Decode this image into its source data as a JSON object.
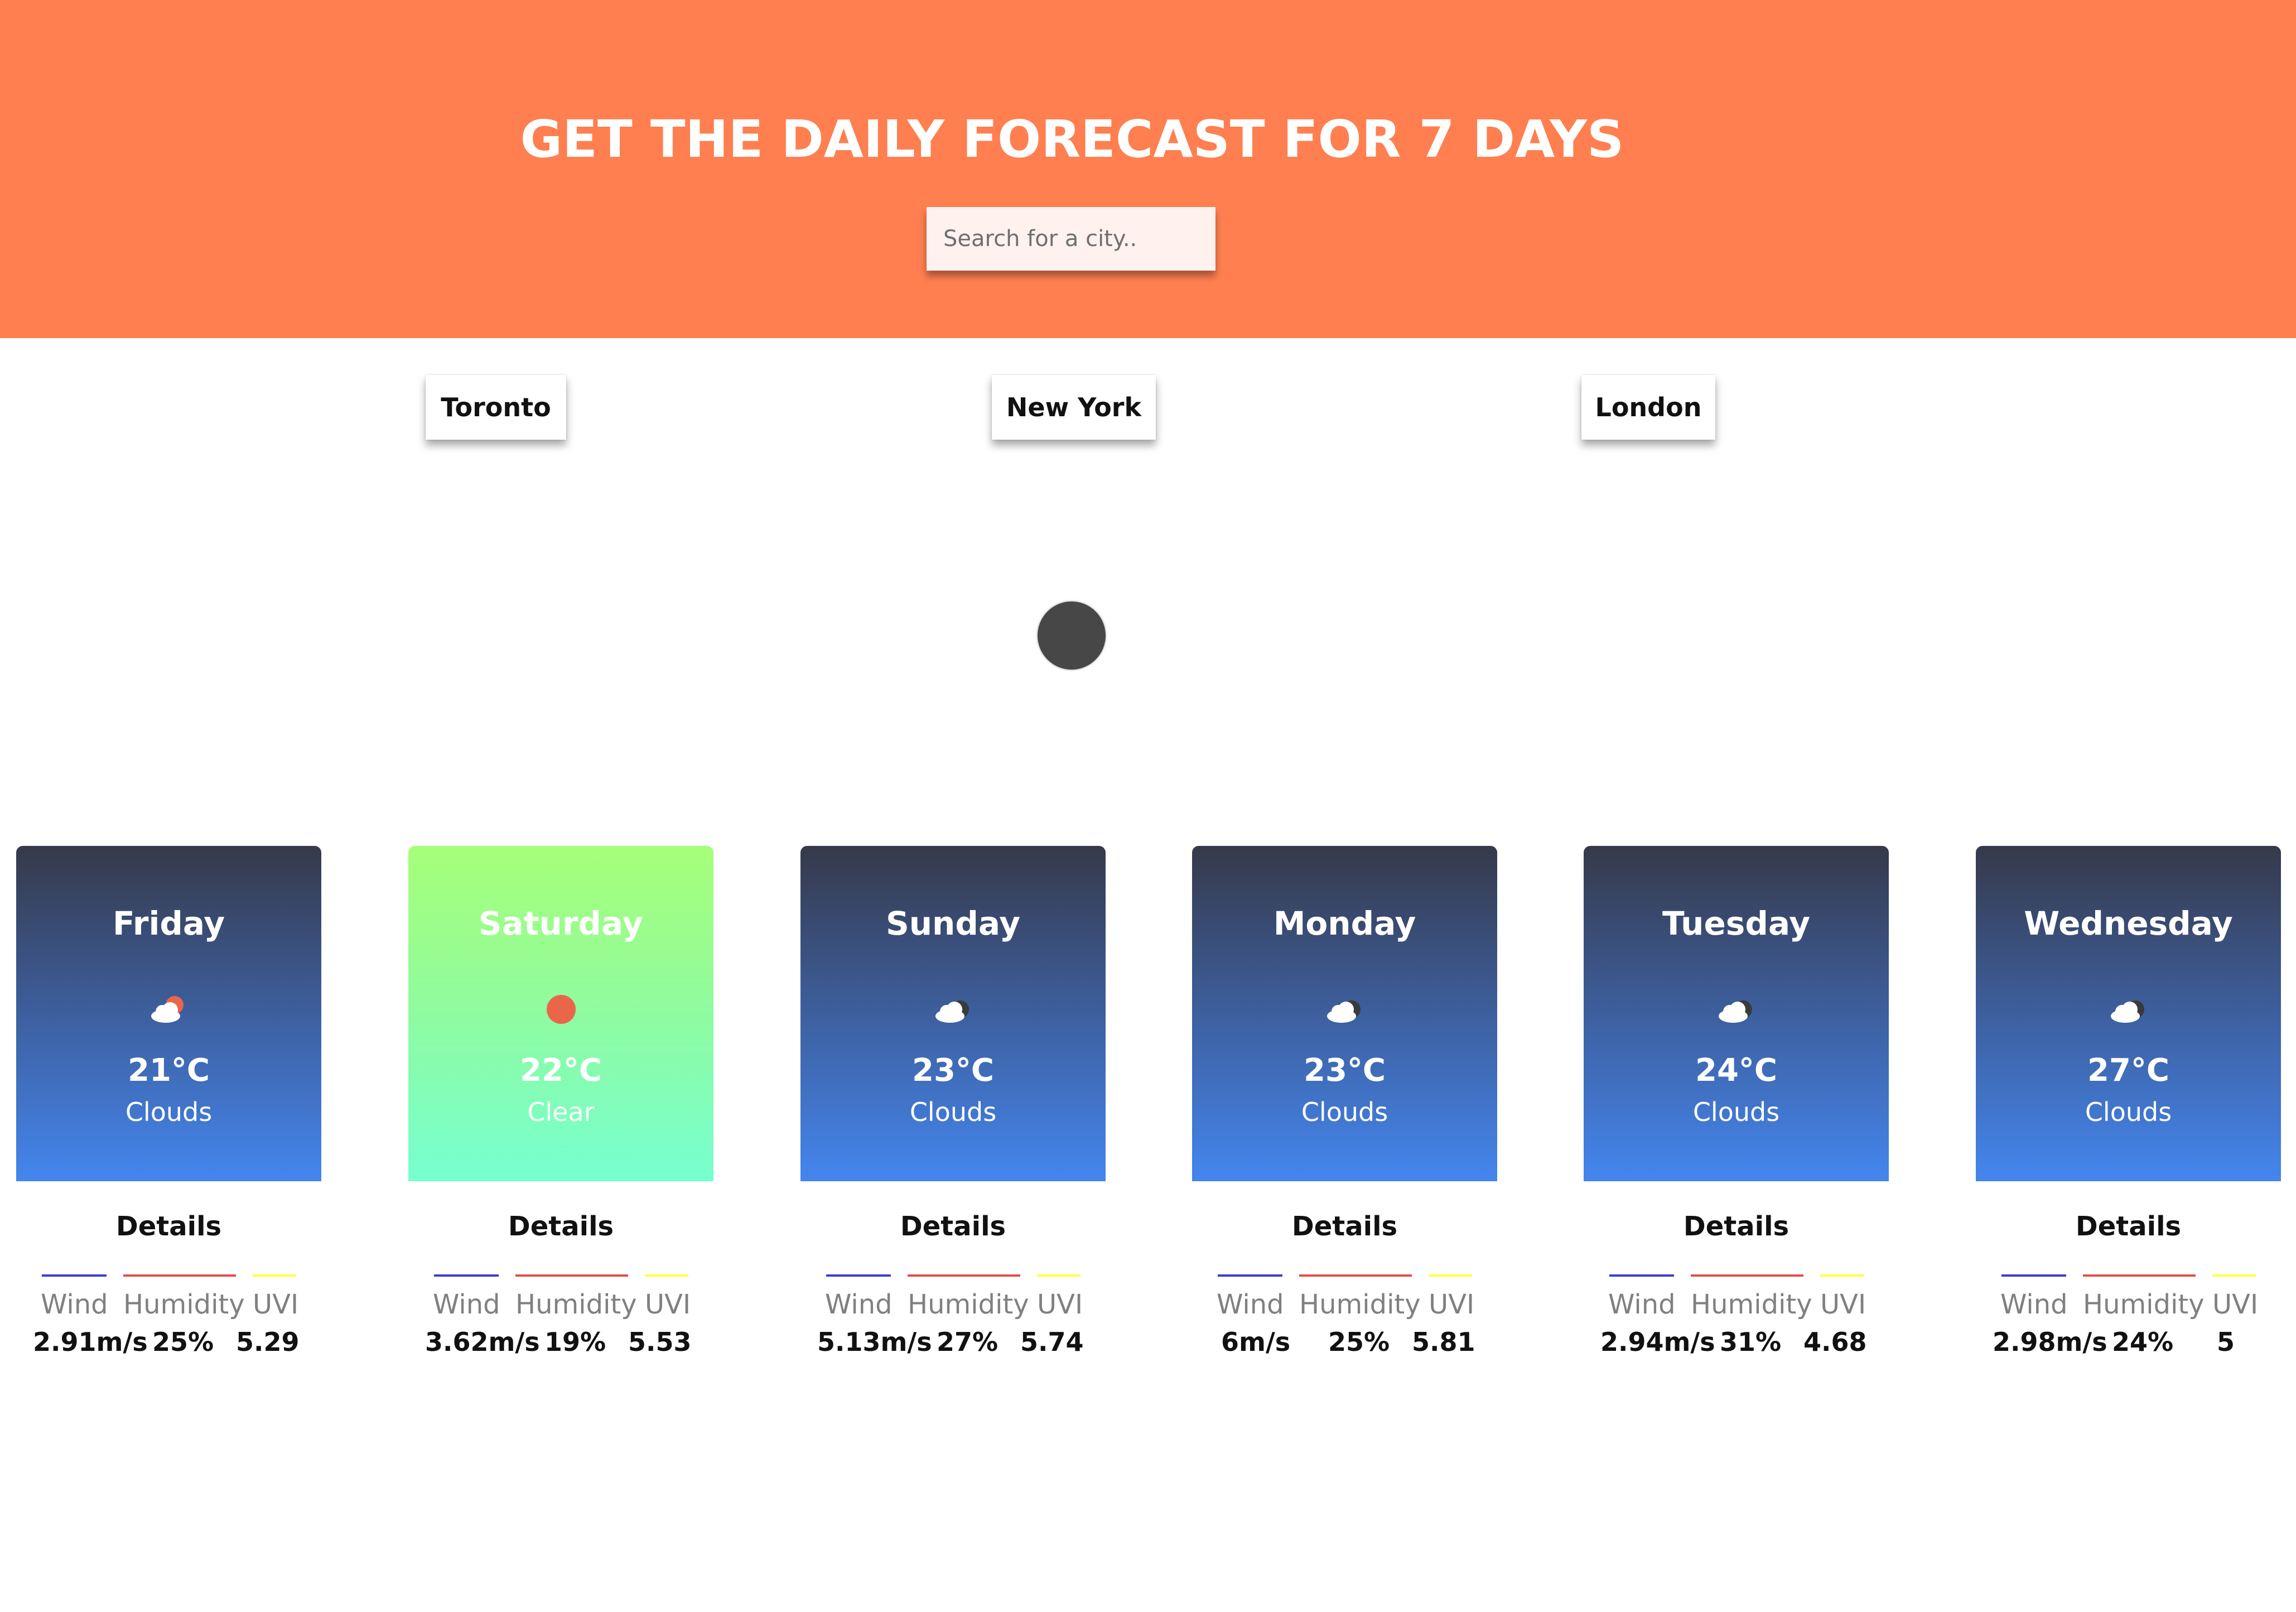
{
  "header": {
    "title": "GET THE DAILY FORECAST FOR 7 DAYS",
    "search_placeholder": "Search for a city..",
    "background": "#ff7f50"
  },
  "cities": [
    "Toronto",
    "New York",
    "London"
  ],
  "details_labels": {
    "title": "Details",
    "wind": "Wind",
    "humidity": "Humidity",
    "uvi": "UVI"
  },
  "legend_colors": {
    "wind": "#3b3bd6",
    "humidity": "#e84a4a",
    "uvi": "#ffff44"
  },
  "forecast": [
    {
      "day": "Friday",
      "temp": "21°C",
      "condition": "Clouds",
      "icon": "cloud-sun-icon",
      "wind": "2.91m/s",
      "humidity": "25%",
      "uvi": "5.29"
    },
    {
      "day": "Saturday",
      "temp": "22°C",
      "condition": "Clear",
      "icon": "sun-icon",
      "wind": "3.62m/s",
      "humidity": "19%",
      "uvi": "5.53"
    },
    {
      "day": "Sunday",
      "temp": "23°C",
      "condition": "Clouds",
      "icon": "cloud-icon",
      "wind": "5.13m/s",
      "humidity": "27%",
      "uvi": "5.74"
    },
    {
      "day": "Monday",
      "temp": "23°C",
      "condition": "Clouds",
      "icon": "cloud-icon",
      "wind": "6m/s",
      "humidity": "25%",
      "uvi": "5.81"
    },
    {
      "day": "Tuesday",
      "temp": "24°C",
      "condition": "Clouds",
      "icon": "cloud-icon",
      "wind": "2.94m/s",
      "humidity": "31%",
      "uvi": "4.68"
    },
    {
      "day": "Wednesday",
      "temp": "27°C",
      "condition": "Clouds",
      "icon": "cloud-icon",
      "wind": "2.98m/s",
      "humidity": "24%",
      "uvi": "5"
    }
  ]
}
